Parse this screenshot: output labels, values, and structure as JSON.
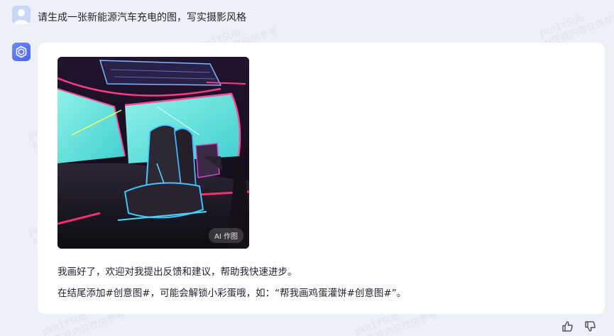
{
  "user_message": {
    "text": "请生成一张新能源汽车充电的图，写实摄影风格"
  },
  "assistant_message": {
    "image_badge": "AI 作图",
    "line1": "我画好了，欢迎对我提出反馈和建议，帮助我快速进步。",
    "line2": "在结尾添加#创意图#，可能会解锁小彩蛋哦，如：“帮我画鸡蛋灌饼#创意图#”。"
  },
  "watermark": {
    "line1": "pkn1YSUb",
    "line2": "AI生成内容仅供参考"
  },
  "icons": {
    "user_avatar": "user-icon",
    "bot_avatar": "cube-logo-icon",
    "thumbs_up": "thumbs-up-icon",
    "thumbs_down": "thumbs-down-icon"
  },
  "colors": {
    "background": "#eef0f7",
    "card": "#ffffff",
    "bot_accent": "#5b73f5",
    "user_avatar_bg": "#c9d6f7"
  }
}
